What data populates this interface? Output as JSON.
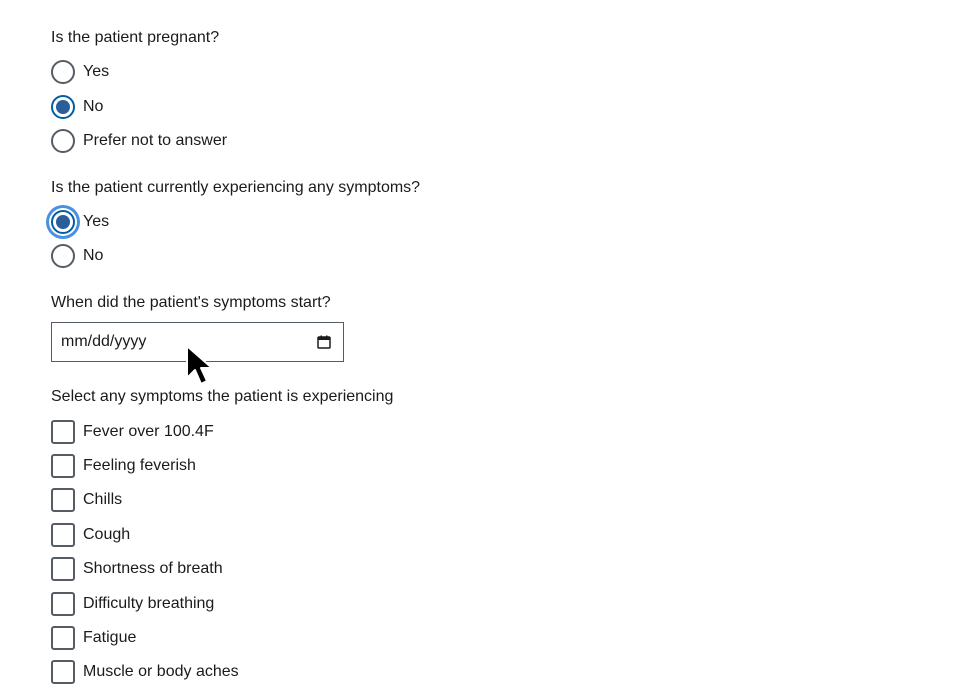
{
  "pregnant": {
    "question": "Is the patient pregnant?",
    "options": [
      "Yes",
      "No",
      "Prefer not to answer"
    ],
    "selected": "No"
  },
  "symptoms_present": {
    "question": "Is the patient currently experiencing any symptoms?",
    "options": [
      "Yes",
      "No"
    ],
    "selected": "Yes"
  },
  "symptom_onset": {
    "question": "When did the patient's symptoms start?",
    "placeholder": "mm/dd/yyyy",
    "icon": "calendar-icon"
  },
  "symptom_list": {
    "question": "Select any symptoms the patient is experiencing",
    "options": [
      "Fever over 100.4F",
      "Feeling feverish",
      "Chills",
      "Cough",
      "Shortness of breath",
      "Difficulty breathing",
      "Fatigue",
      "Muscle or body aches"
    ]
  },
  "colors": {
    "radio_selected": "#2b5d99",
    "focus_ring": "#4a90e2",
    "border": "#565c65",
    "text": "#1b1b1b"
  }
}
